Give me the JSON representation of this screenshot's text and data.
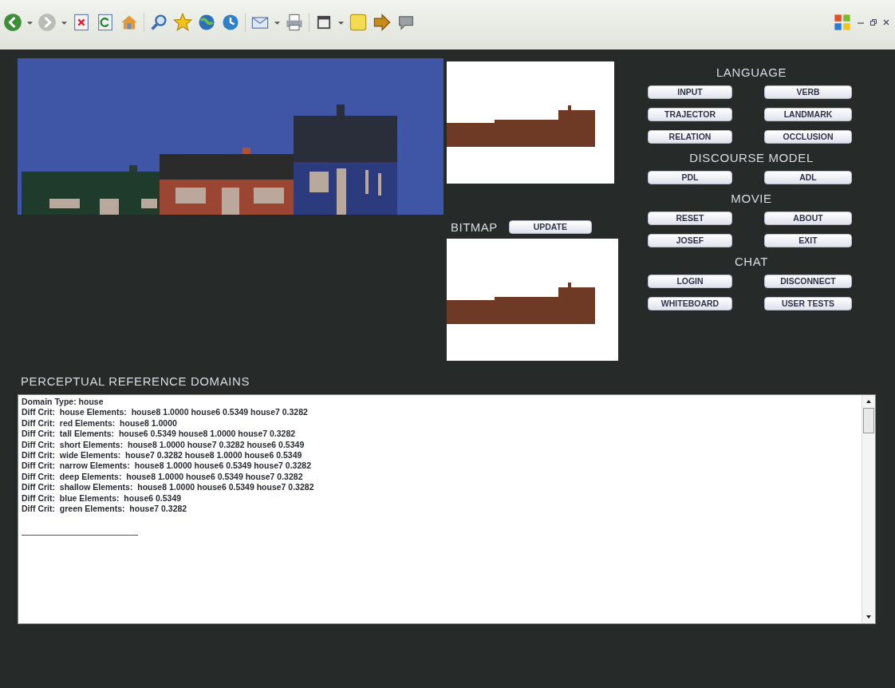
{
  "bitmap": {
    "label": "BITMAP",
    "update_button": "UPDATE"
  },
  "control_panel": [
    {
      "heading": "LANGUAGE",
      "buttons": [
        "INPUT",
        "VERB",
        "TRAJECTOR",
        "LANDMARK",
        "RELATION",
        "OCCLUSION"
      ]
    },
    {
      "heading": "DISCOURSE MODEL",
      "buttons": [
        "PDL",
        "ADL"
      ]
    },
    {
      "heading": "MOVIE",
      "buttons": [
        "RESET",
        "ABOUT",
        "JOSEF",
        "EXIT"
      ]
    },
    {
      "heading": "CHAT",
      "buttons": [
        "LOGIN",
        "DISCONNECT",
        "WHITEBOARD",
        "USER TESTS"
      ]
    }
  ],
  "domains": {
    "title": "PERCEPTUAL REFERENCE DOMAINS",
    "lines": [
      "Domain Type: house",
      "Diff Crit:  house Elements:  house8 1.0000 house6 0.5349 house7 0.3282",
      "Diff Crit:  red Elements:  house8 1.0000",
      "Diff Crit:  tall Elements:  house6 0.5349 house8 1.0000 house7 0.3282",
      "Diff Crit:  short Elements:  house8 1.0000 house7 0.3282 house6 0.5349",
      "Diff Crit:  wide Elements:  house7 0.3282 house8 1.0000 house6 0.5349",
      "Diff Crit:  narrow Elements:  house8 1.0000 house6 0.5349 house7 0.3282",
      "Diff Crit:  deep Elements:  house8 1.0000 house6 0.5349 house7 0.3282",
      "Diff Crit:  shallow Elements:  house8 1.0000 house6 0.5349 house7 0.3282",
      "Diff Crit:  blue Elements:  house6 0.5349",
      "Diff Crit:  green Elements:  house7 0.3282"
    ]
  }
}
